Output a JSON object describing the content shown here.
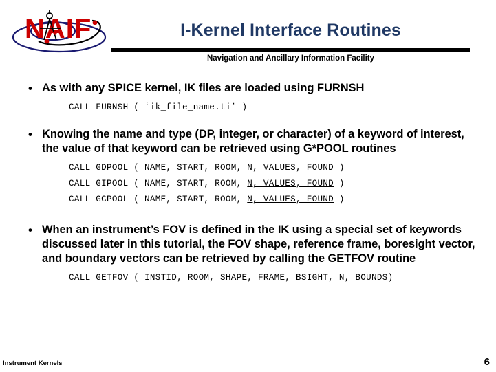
{
  "header": {
    "title": "I-Kernel Interface Routines",
    "subtitle": "Navigation and Ancillary Information Facility",
    "logo_text": "NAIF",
    "title_color": "#1f3864",
    "logo_red": "#cc0000",
    "logo_blue": "#191970"
  },
  "content": {
    "bullets": [
      {
        "marker": "•",
        "text": "As with any SPICE kernel, IK files are loaded using FURNSH"
      },
      {
        "marker": "•",
        "text": "Knowing the name and type (DP, integer, or character) of a keyword of interest, the value of that keyword can be retrieved using G*POOL routines"
      },
      {
        "marker": "•",
        "text": "When an instrument’s FOV is defined in the IK using a special set of keywords discussed later in this tutorial, the FOV shape, reference frame, boresight vector, and boundary vectors can be retrieved by calling the GETFOV routine"
      }
    ],
    "code_furnsh": [
      {
        "plain": "CALL FURNSH ( ʻik_file_name.tiʼ )",
        "underlined": "",
        "tail": ""
      }
    ],
    "code_pool": [
      {
        "plain": "CALL GDPOOL ( NAME, START, ROOM, ",
        "underlined": "N, VALUES, FOUND",
        "tail": " )"
      },
      {
        "plain": "CALL GIPOOL ( NAME, START, ROOM, ",
        "underlined": "N, VALUES, FOUND",
        "tail": " )"
      },
      {
        "plain": "CALL GCPOOL ( NAME, START, ROOM, ",
        "underlined": "N, VALUES, FOUND",
        "tail": " )"
      }
    ],
    "code_getfov": [
      {
        "plain": "CALL GETFOV ( INSTID, ROOM, ",
        "underlined": "SHAPE, FRAME, BSIGHT, N, BOUNDS",
        "tail": ")"
      }
    ]
  },
  "footer": {
    "section_label": "Instrument Kernels",
    "page_number": "6"
  }
}
